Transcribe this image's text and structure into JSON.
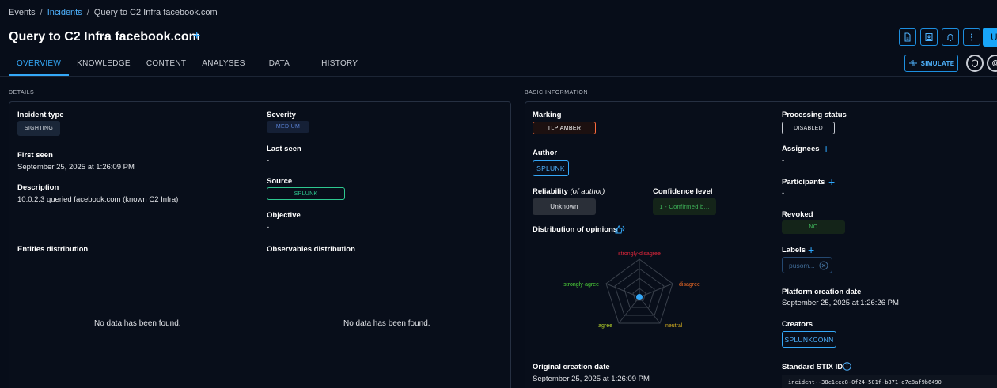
{
  "breadcrumb": {
    "events": "Events",
    "incidents": "Incidents",
    "current": "Query to C2 Infra facebook.com",
    "sep": "/"
  },
  "page_title": "Query to C2 Infra facebook.com",
  "title_plus": "+",
  "tabs": [
    {
      "label": "OVERVIEW"
    },
    {
      "label": "KNOWLEDGE"
    },
    {
      "label": "CONTENT"
    },
    {
      "label": "ANALYSES"
    },
    {
      "label": "DATA"
    },
    {
      "label": "HISTORY"
    }
  ],
  "toolbar": {
    "update_label": "U",
    "simulate_label": "SIMULATE"
  },
  "details": {
    "section_title": "DETAILS",
    "incident_type_label": "Incident type",
    "incident_type_value": "SIGHTING",
    "severity_label": "Severity",
    "severity_value": "MEDIUM",
    "first_seen_label": "First seen",
    "first_seen_value": "September 25, 2025 at 1:26:09 PM",
    "last_seen_label": "Last seen",
    "last_seen_value": "-",
    "description_label": "Description",
    "description_value": "10.0.2.3 queried facebook.com (known C2 Infra)",
    "source_label": "Source",
    "source_value": "SPLUNK",
    "objective_label": "Objective",
    "objective_value": "-",
    "entities_label": "Entities distribution",
    "observables_label": "Observables distribution",
    "entities_nodata": "No data has been found.",
    "observables_nodata": "No data has been found."
  },
  "basic": {
    "section_title": "BASIC INFORMATION",
    "marking_label": "Marking",
    "marking_value": "TLP:AMBER",
    "author_label": "Author",
    "author_value": "SPLUNK",
    "reliability_label": "Reliability",
    "reliability_sub": "(of author)",
    "reliability_value": "Unknown",
    "confidence_label": "Confidence level",
    "confidence_value": "1 - Confirmed b...",
    "opinions_label": "Distribution of opinions",
    "radar": {
      "strongly_disagree": "strongly-disagree",
      "disagree": "disagree",
      "neutral": "neutral",
      "agree": "agree",
      "strongly_agree": "strongly-agree"
    },
    "original_creation_label": "Original creation date",
    "original_creation_value": "September 25, 2025 at 1:26:09 PM",
    "processing_label": "Processing status",
    "processing_value": "DISABLED",
    "assignees_label": "Assignees",
    "assignees_value": "-",
    "participants_label": "Participants",
    "participants_value": "-",
    "revoked_label": "Revoked",
    "revoked_value": "NO",
    "labels_label": "Labels",
    "labels_value": "pusom...",
    "platform_creation_label": "Platform creation date",
    "platform_creation_value": "September 25, 2025 at 1:26:26 PM",
    "creators_label": "Creators",
    "creators_value": "SPLUNKCONN",
    "stix_label": "Standard STIX ID",
    "stix_value": "incident--38c1cec8-0f24-501f-b871-d7e8af9b6490"
  },
  "colors": {
    "accent": "#34a8f8",
    "amber": "#ff6b3d",
    "strongly_disagree": "#e0263b",
    "disagree": "#f26b25",
    "neutral": "#d6b020",
    "agree": "#b8d62a",
    "strongly_agree": "#4fd63a"
  }
}
